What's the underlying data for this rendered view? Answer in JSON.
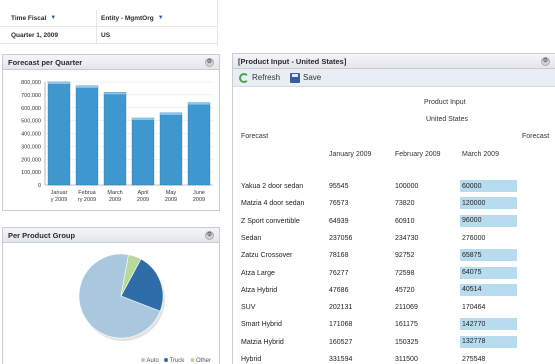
{
  "pov": {
    "dim1_label": "Time Fiscal",
    "dim2_label": "Entity - MgmtOrg",
    "dim1_value": "Quarter 1, 2009",
    "dim2_value": "US"
  },
  "forecast_panel": {
    "title": "Forecast per Quarter"
  },
  "group_panel": {
    "title": "Per Product Group"
  },
  "input_panel": {
    "title": "[Product Input - United States]",
    "refresh_label": "Refresh",
    "save_label": "Save",
    "header_product": "Product Input",
    "header_entity": "United States",
    "row_dim_label": "Forecast",
    "right_label": "Forecast",
    "columns": [
      "January 2009",
      "February 2009",
      "March 2009"
    ],
    "rows": [
      {
        "name": "Yakua 2 door sedan",
        "values": [
          "95545",
          "100000",
          "60000"
        ],
        "editable": true
      },
      {
        "name": "Matzia 4 door sedan",
        "values": [
          "76573",
          "73820",
          "120000"
        ],
        "editable": true
      },
      {
        "name": "Z Sport convertible",
        "values": [
          "64939",
          "60910",
          "96000"
        ],
        "editable": true
      },
      {
        "name": "Sedan",
        "values": [
          "237056",
          "234730",
          "276000"
        ],
        "editable": false
      },
      {
        "name": "Zatzu Crossover",
        "values": [
          "78168",
          "92752",
          "65875"
        ],
        "editable": true
      },
      {
        "name": "Atza Large",
        "values": [
          "76277",
          "72598",
          "64075"
        ],
        "editable": true
      },
      {
        "name": "Atza Hybrid",
        "values": [
          "47686",
          "45720",
          "40514"
        ],
        "editable": true
      },
      {
        "name": "SUV",
        "values": [
          "202131",
          "211069",
          "170464"
        ],
        "editable": false
      },
      {
        "name": "Smart Hybrid",
        "values": [
          "171068",
          "161175",
          "142770"
        ],
        "editable": true
      },
      {
        "name": "Matzia Hybrid",
        "values": [
          "160527",
          "150325",
          "132778"
        ],
        "editable": true
      },
      {
        "name": "Hybrid",
        "values": [
          "331594",
          "311500",
          "275548"
        ],
        "editable": false
      }
    ]
  },
  "chart_data": [
    {
      "type": "bar",
      "title": "Forecast per Quarter",
      "categories": [
        "January 2009",
        "February 2009",
        "March 2009",
        "April 2009",
        "May 2009",
        "June 2009"
      ],
      "category_lines": [
        [
          "Januar",
          "y 2009"
        ],
        [
          "Februa",
          "ry 2009"
        ],
        [
          "March",
          "2009"
        ],
        [
          "April",
          "2009"
        ],
        [
          "May",
          "2009"
        ],
        [
          "June",
          "2009"
        ]
      ],
      "values": [
        800000,
        770000,
        720000,
        520000,
        560000,
        640000
      ],
      "ylim": [
        0,
        800000
      ],
      "yticks": [
        "0",
        "100,000",
        "200,000",
        "300,000",
        "400,000",
        "500,000",
        "600,000",
        "700,000",
        "800,000"
      ],
      "grid": true,
      "color": "#3f97cf"
    },
    {
      "type": "pie",
      "title": "Per Product Group",
      "labels": [
        "Auto",
        "Truck",
        "Other"
      ],
      "values": [
        72,
        23,
        5
      ],
      "colors": [
        "#a9c8de",
        "#2f6da8",
        "#b9d99a"
      ],
      "legend": "bottom-right"
    }
  ]
}
